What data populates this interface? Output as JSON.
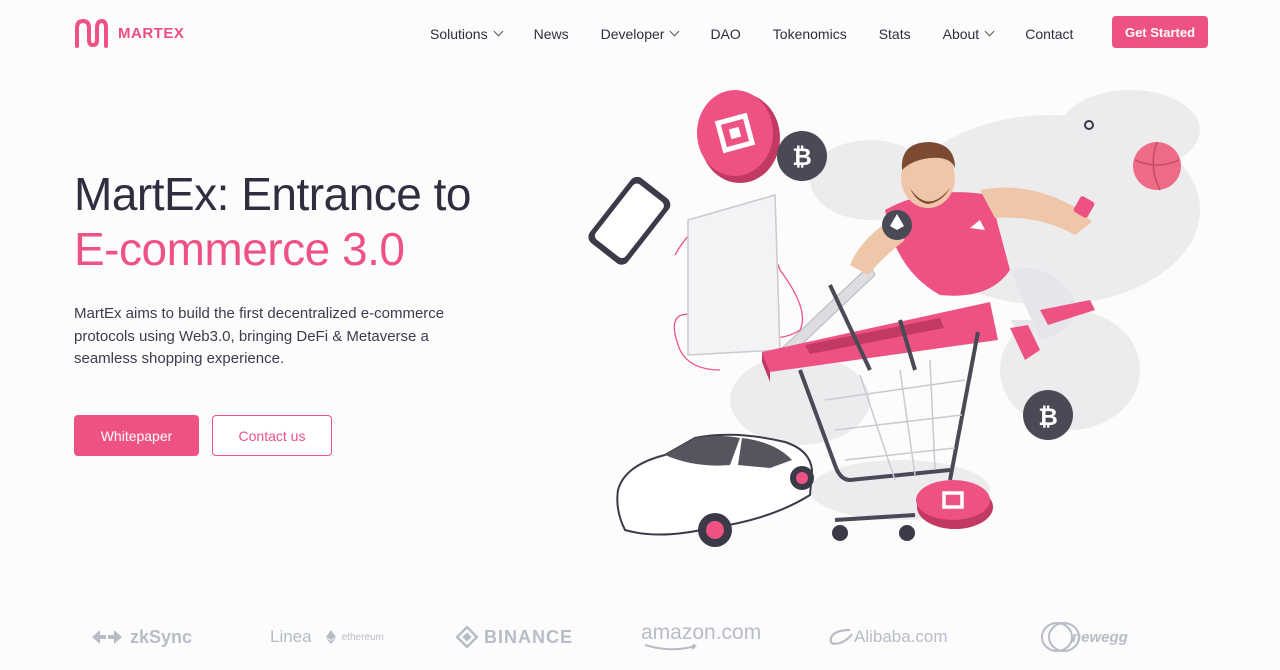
{
  "brand": {
    "name": "MARTEX",
    "accent": "#ee5283"
  },
  "nav": {
    "items": [
      {
        "label": "Solutions",
        "dropdown": true
      },
      {
        "label": "News",
        "dropdown": false
      },
      {
        "label": "Developer",
        "dropdown": true
      },
      {
        "label": "DAO",
        "dropdown": false
      },
      {
        "label": "Tokenomics",
        "dropdown": false
      },
      {
        "label": "Stats",
        "dropdown": false
      },
      {
        "label": "About",
        "dropdown": true
      },
      {
        "label": "Contact",
        "dropdown": false
      }
    ],
    "cta_label": "Get Started"
  },
  "hero": {
    "title_line1": "MartEx: Entrance to",
    "title_line2": "E-commerce 3.0",
    "description": "MartEx aims to build the first decentralized e-commerce protocols using Web3.0, bringing DeFi & Metaverse a seamless shopping experience.",
    "primary_button": "Whitepaper",
    "secondary_button": "Contact us"
  },
  "partners": [
    {
      "name": "zkSync",
      "icon": "zksync-arrows-icon"
    },
    {
      "name": "Linea",
      "sub": "ethereum",
      "icon": "ethereum-icon"
    },
    {
      "name": "BINANCE",
      "icon": "binance-diamond-icon"
    },
    {
      "name": "amazon.com",
      "icon": "amazon-smile-icon"
    },
    {
      "name": "Alibaba.com",
      "icon": "alibaba-icon"
    },
    {
      "name": "newegg",
      "icon": "newegg-icon"
    }
  ]
}
